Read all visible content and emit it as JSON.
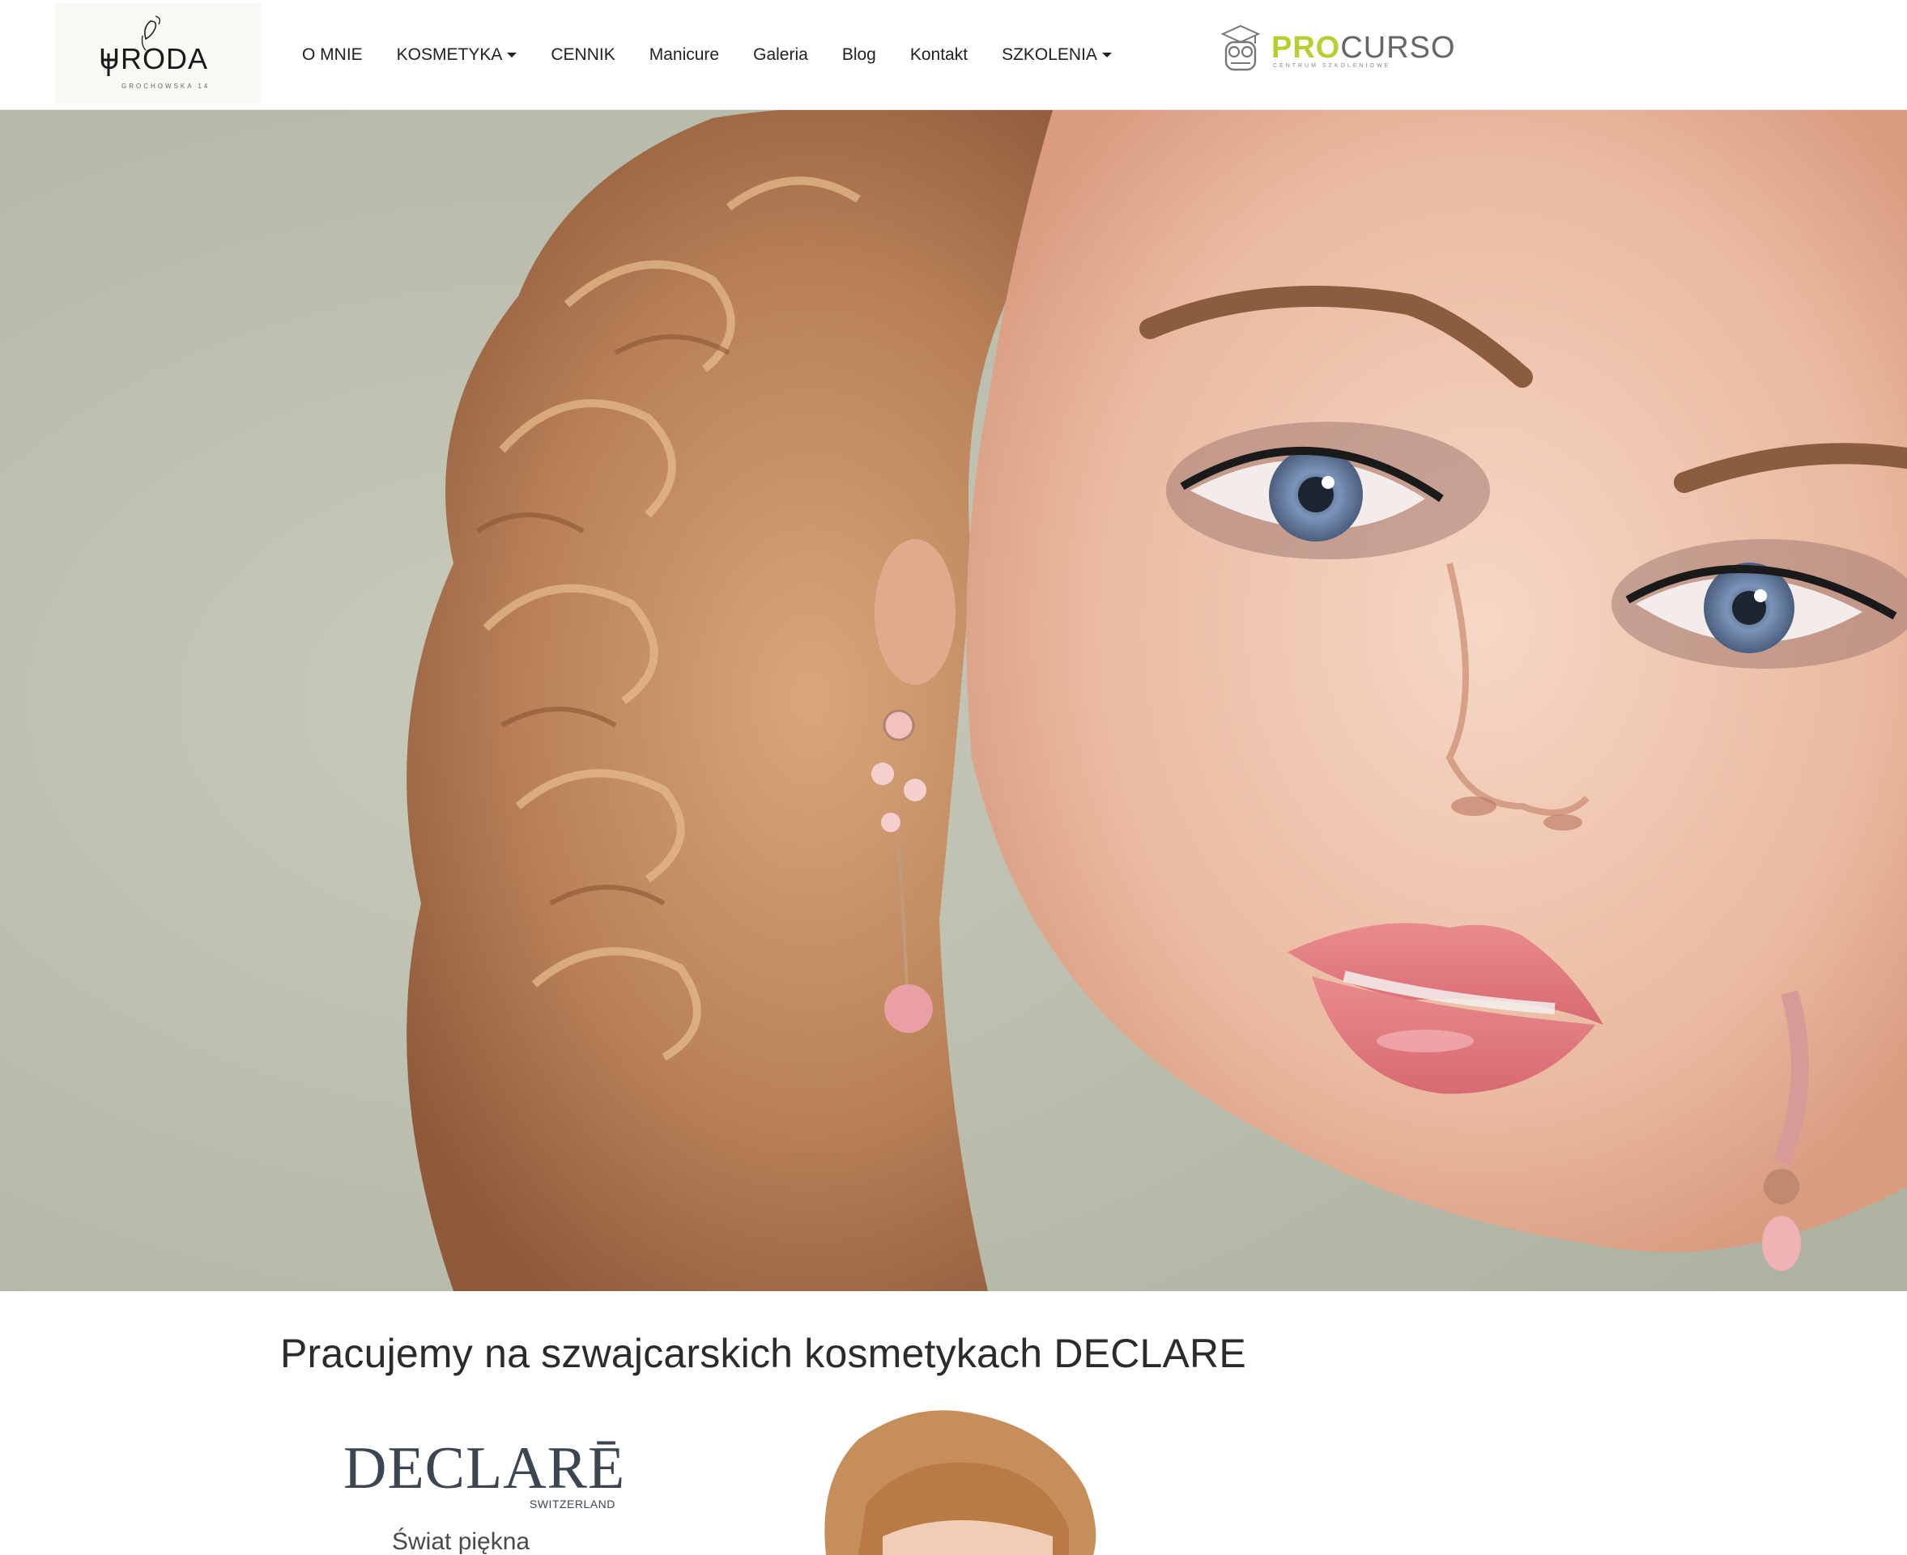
{
  "brand": {
    "name": "URODA",
    "tagline": "GROCHOWSKA 14"
  },
  "nav": {
    "items": [
      {
        "label": "O MNIE",
        "dropdown": false
      },
      {
        "label": "KOSMETYKA",
        "dropdown": true
      },
      {
        "label": "CENNIK",
        "dropdown": false
      },
      {
        "label": "Manicure",
        "dropdown": false
      },
      {
        "label": "Galeria",
        "dropdown": false
      },
      {
        "label": "Blog",
        "dropdown": false
      },
      {
        "label": "Kontakt",
        "dropdown": false
      },
      {
        "label": "SZKOLENIA",
        "dropdown": true
      }
    ]
  },
  "partner": {
    "name_part1": "PRO",
    "name_part2": "CURSO",
    "subtitle": "CENTRUM SZKOLENIOWE"
  },
  "content": {
    "heading": "Pracujemy na szwajcarskich kosmetykach DECLARE",
    "declare_logo": {
      "name": "DECLARĒ",
      "country": "SWITZERLAND",
      "tagline": "Świat piękna"
    }
  },
  "colors": {
    "accent_green": "#b9cf2f",
    "hero_background": "#b9bcab",
    "declare_blue": "#3c4652"
  }
}
